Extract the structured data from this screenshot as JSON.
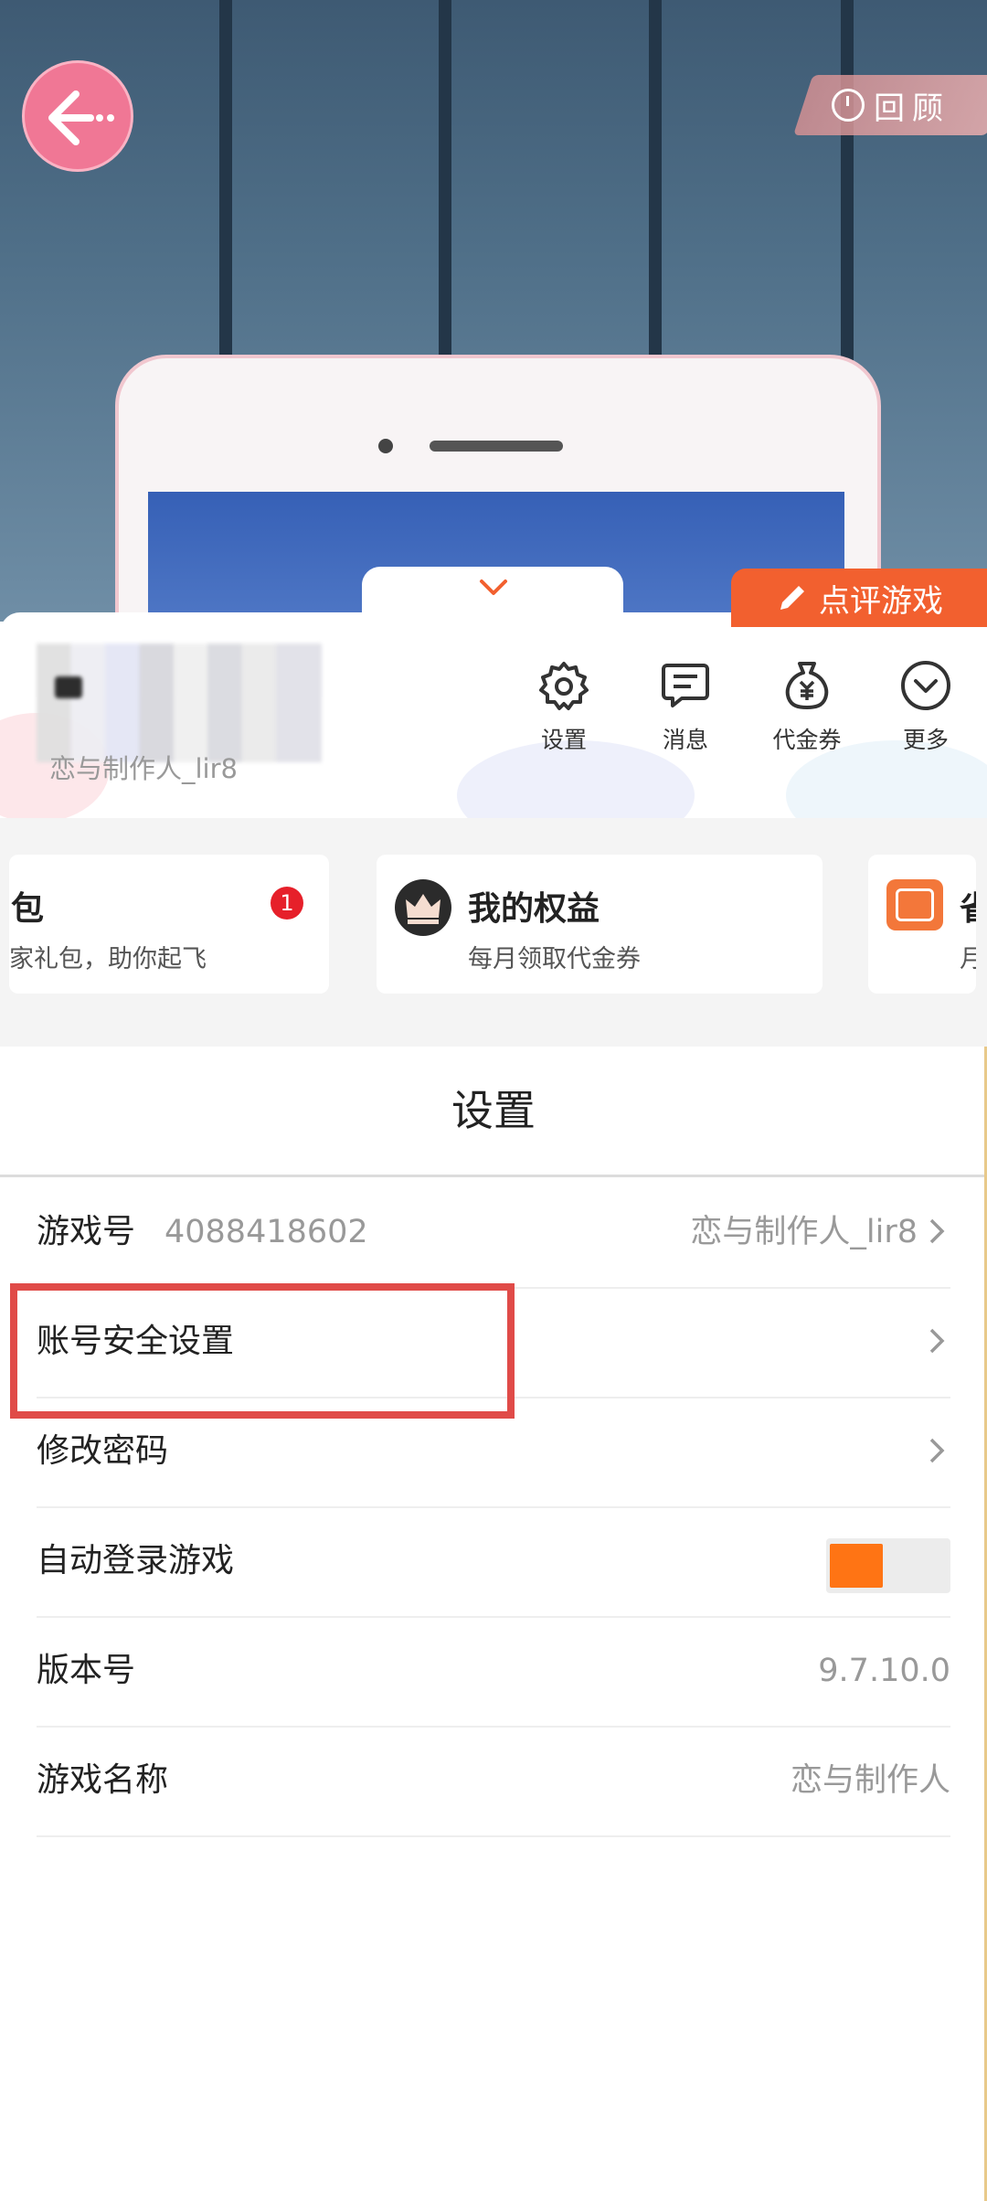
{
  "top": {
    "review_label": "回顾"
  },
  "panel": {
    "comment_label": "点评游戏",
    "user_name": "恋与制作人_lir8",
    "quick_actions": [
      {
        "label": "设置",
        "icon": "gear-icon"
      },
      {
        "label": "消息",
        "icon": "message-icon"
      },
      {
        "label": "代金券",
        "icon": "coupon-bag-icon"
      },
      {
        "label": "更多",
        "icon": "chevron-circle-icon"
      }
    ]
  },
  "cards": [
    {
      "title": "包",
      "subtitle": "家礼包，助你起飞",
      "badge": "1"
    },
    {
      "title": "我的权益",
      "subtitle": "每月领取代金券"
    },
    {
      "title": "省",
      "subtitle": "月"
    }
  ],
  "settings": {
    "title": "设置",
    "rows": [
      {
        "label": "游戏号",
        "middle": "4088418602",
        "value": "恋与制作人_lir8"
      },
      {
        "label": "账号安全设置"
      },
      {
        "label": "修改密码"
      },
      {
        "label": "自动登录游戏",
        "toggle_on": true
      },
      {
        "label": "版本号",
        "value": "9.7.10.0"
      },
      {
        "label": "游戏名称",
        "value": "恋与制作人"
      }
    ]
  },
  "colors": {
    "accent_orange": "#f2602f",
    "toggle_orange": "#ff7414",
    "highlight_red": "#e04b48",
    "back_pink": "#f07795"
  }
}
